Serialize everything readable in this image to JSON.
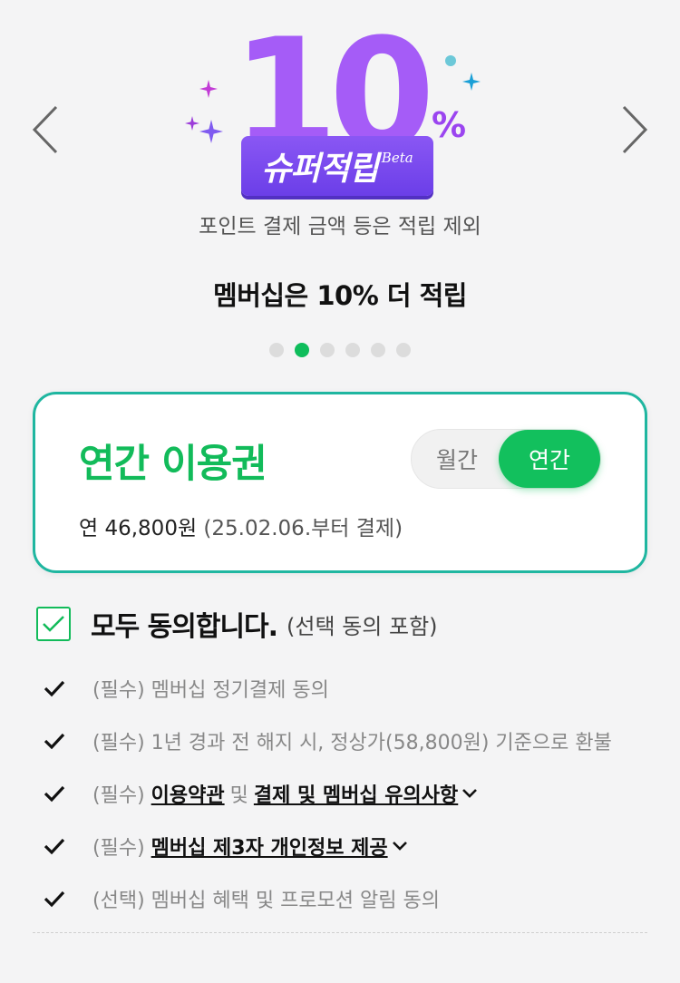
{
  "banner": {
    "big_number": "10",
    "percent_sign": "%",
    "label": "슈퍼적립",
    "beta": "Beta",
    "caption": "포인트 결제 금액 등은 적립 제외"
  },
  "headline": "멤버십은 10% 더 적립",
  "carousel": {
    "total_slides": 6,
    "active_index": 1
  },
  "plan": {
    "title": "연간 이용권",
    "toggle": {
      "monthly": "월간",
      "yearly": "연간",
      "selected": "yearly"
    },
    "price": "연 46,800원",
    "price_note": "(25.02.06.부터 결제)"
  },
  "agreement": {
    "all_label": "모두 동의합니다.",
    "all_sub": "(선택 동의 포함)",
    "all_checked": true,
    "terms": [
      {
        "prefix": "(필수)",
        "text": "멤버십 정기결제 동의",
        "checked": true
      },
      {
        "prefix": "(필수)",
        "text": "1년 경과 전 해지 시, 정상가(58,800원) 기준으로 환불",
        "checked": true
      },
      {
        "prefix": "(필수)",
        "link1": "이용약관",
        "joiner": "및",
        "link2": "결제 및 멤버십 유의사항",
        "checked": true
      },
      {
        "prefix": "(필수)",
        "link1": "멤버십 제3자 개인정보 제공",
        "checked": true
      },
      {
        "prefix": "(선택)",
        "text": "멤버십 혜택 및 프로모션 알림 동의",
        "checked": true
      }
    ]
  },
  "colors": {
    "accent_green": "#12bb5a",
    "card_border": "#1fb6a0",
    "banner_purple": "#a55cf7"
  },
  "icons": [
    "chevron-left-icon",
    "chevron-right-icon",
    "checkmark-icon",
    "chevron-down-icon",
    "sparkle-icon"
  ]
}
